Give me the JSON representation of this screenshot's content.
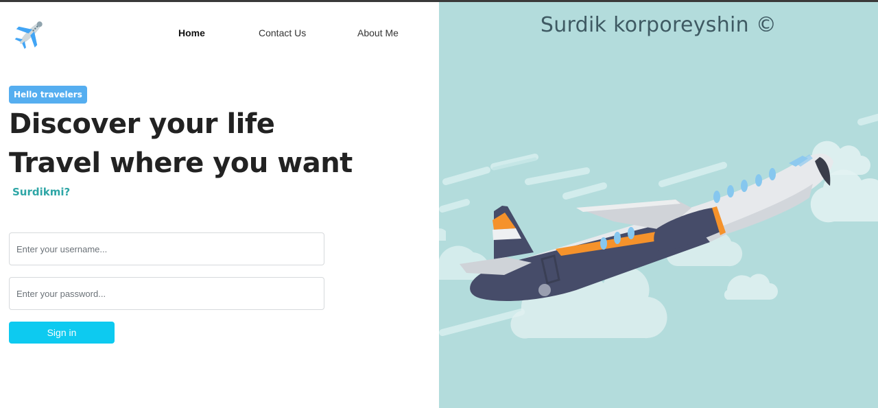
{
  "nav": {
    "home": "Home",
    "contact": "Contact Us",
    "about": "About Me"
  },
  "hero": {
    "badge": "Hello travelers",
    "line1": "Discover your life",
    "line2": "Travel where you want",
    "tagline": "Surdikmi?"
  },
  "form": {
    "username_placeholder": "Enter your username...",
    "password_placeholder": "Enter your password...",
    "submit_label": "Sign in"
  },
  "brand": {
    "text": "Surdik korporeyshin ©"
  },
  "icons": {
    "logo": "airplane-icon",
    "illustration": "airplane-illustration"
  },
  "colors": {
    "badge": "#55aef0",
    "tagline": "#2ea6a6",
    "button": "#0dcaf0",
    "right_panel": "#b3dcdc"
  }
}
